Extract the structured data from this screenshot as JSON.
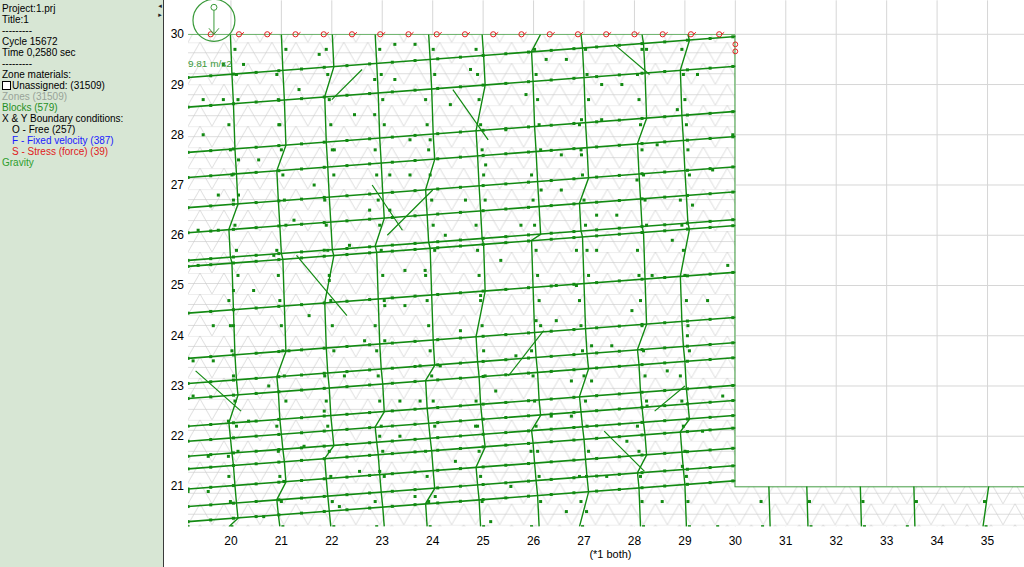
{
  "sidebar": {
    "lines": [
      {
        "text": "Project:1.prj",
        "kind": "text",
        "disabled": false
      },
      {
        "text": "Title:1",
        "kind": "text",
        "disabled": false
      },
      {
        "text": "---------",
        "kind": "text",
        "disabled": false
      },
      {
        "text": "Cycle 15672",
        "kind": "text",
        "disabled": false
      },
      {
        "text": "Time 0,2580 sec",
        "kind": "text",
        "disabled": false
      },
      {
        "text": "---------",
        "kind": "text",
        "disabled": false
      },
      {
        "text": "Zone materials:",
        "kind": "text",
        "disabled": false
      },
      {
        "text": "Unassigned: (31509)",
        "kind": "checkbox",
        "checked": false,
        "disabled": false
      },
      {
        "text": "Zones (31509)",
        "kind": "text",
        "disabled": true
      },
      {
        "text": "Blocks (579)",
        "kind": "legend",
        "color": "#1f8f1f",
        "disabled": false
      },
      {
        "text": "X & Y Boundary conditions:",
        "kind": "text",
        "disabled": false
      },
      {
        "text": "O - Free (257)",
        "kind": "boundary",
        "color": "#000000",
        "disabled": false
      },
      {
        "text": "F - Fixed velocity (387)",
        "kind": "boundary",
        "color": "#1a1aff",
        "disabled": false
      },
      {
        "text": "S - Stress (force) (39)",
        "kind": "boundary",
        "color": "#e02020",
        "disabled": false
      },
      {
        "text": "Gravity",
        "kind": "legend",
        "color": "#2e9e2e",
        "disabled": false
      }
    ]
  },
  "divider": {
    "arrows": [
      "◂",
      "▸"
    ]
  },
  "plot": {
    "gravity": {
      "label": "9.81 m/s2"
    },
    "y_ticks": [
      "30",
      "29",
      "28",
      "27",
      "26",
      "25",
      "24",
      "23",
      "22",
      "21"
    ],
    "x_ticks": [
      "20",
      "21",
      "22",
      "23",
      "24",
      "25",
      "26",
      "27",
      "28",
      "29",
      "30",
      "31",
      "32",
      "33",
      "34",
      "35"
    ],
    "footer": "(*1 both)"
  }
}
